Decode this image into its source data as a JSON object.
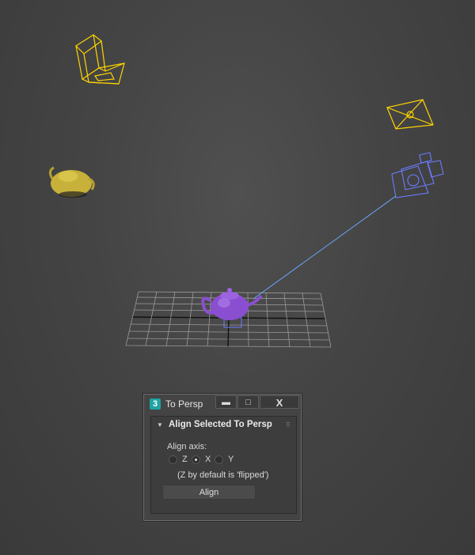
{
  "dialog": {
    "app_icon": "3",
    "title": "To Persp",
    "buttons": {
      "minimize": "▬",
      "maximize": "□",
      "close": "X"
    }
  },
  "rollout": {
    "title": "Align Selected To Persp",
    "align_axis_label": "Align axis:",
    "options": [
      {
        "label": "Z",
        "selected": false
      },
      {
        "label": "X",
        "selected": true
      },
      {
        "label": "Y",
        "selected": false
      }
    ],
    "note": "(Z by default is 'flipped')",
    "align_button": "Align"
  },
  "scene": {
    "background": "#444444",
    "objects": [
      "camera-wireframe-icon",
      "light-icon",
      "yellow-teapot",
      "purple-teapot",
      "blue-camera-icon",
      "grid"
    ],
    "colors": {
      "camera": "#ffd400",
      "selected": "#6b7bff",
      "teapot_yellow": "#c8b13a",
      "teapot_purple": "#8a4fd0",
      "grid": "#9a9a9a"
    }
  }
}
